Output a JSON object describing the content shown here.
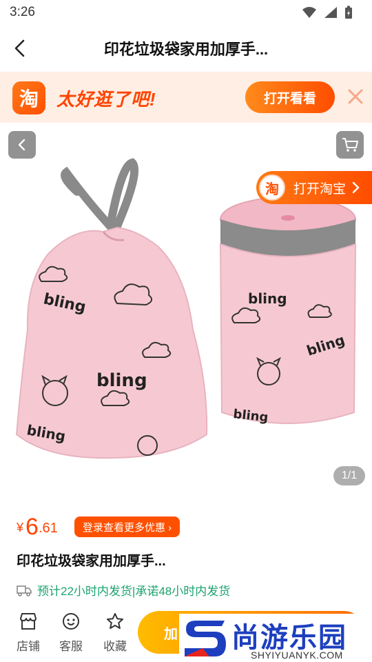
{
  "status_bar": {
    "time": "3:26"
  },
  "header": {
    "title": "印花垃圾袋家用加厚手..."
  },
  "promo": {
    "logo_char": "淘",
    "slogan": "太好逛了吧!",
    "open_button": "打开看看"
  },
  "gallery": {
    "open_app_label": "打开淘宝",
    "pill_logo_char": "淘",
    "page_indicator": "1/1",
    "printed_text": [
      "bling",
      "bling",
      "bling",
      "bling",
      "bling",
      "bling"
    ]
  },
  "price": {
    "symbol": "¥",
    "integer": "6",
    "decimal": ".61",
    "discount_button": "登录查看更多优惠 ›"
  },
  "product": {
    "name": "印花垃圾袋家用加厚手..."
  },
  "shipping": {
    "text": "预计22小时内发货|承诺48小时内发货"
  },
  "bottom_nav": {
    "shop": "店铺",
    "service": "客服",
    "favorite": "收藏",
    "add_cart": "加"
  },
  "watermark": {
    "title": "尚游乐园",
    "url": "SHYIYUANYK.COM"
  },
  "colors": {
    "accent": "#ff5000",
    "ship_green": "#1aa36e",
    "bag_pink": "#f6c9d2"
  }
}
